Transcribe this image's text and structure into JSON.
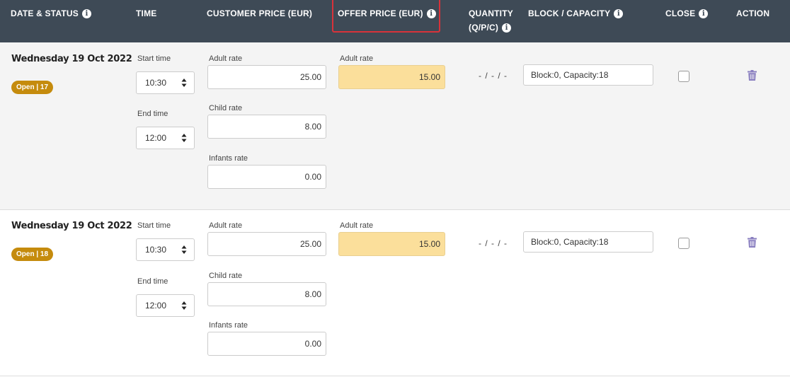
{
  "header": {
    "date_status": "DATE & STATUS",
    "time": "TIME",
    "customer_price": "CUSTOMER PRICE (EUR)",
    "offer_price": "OFFER PRICE (EUR)",
    "quantity_line1": "QUANTITY",
    "quantity_line2": "(Q/P/C)",
    "block_capacity": "BLOCK / CAPACITY",
    "close": "CLOSE",
    "action": "ACTION",
    "info_glyph": "i"
  },
  "rows": [
    {
      "date": "Wednesday 19 Oct 2022",
      "status": "Open | 17",
      "start_label": "Start time",
      "start_value": "10:30",
      "end_label": "End time",
      "end_value": "12:00",
      "adult_label": "Adult rate",
      "adult_value": "25.00",
      "child_label": "Child rate",
      "child_value": "8.00",
      "infant_label": "Infants rate",
      "infant_value": "0.00",
      "offer_label": "Adult rate",
      "offer_value": "15.00",
      "quantity": "- / - / -",
      "block": "Block:0, Capacity:18",
      "closed": false
    },
    {
      "date": "Wednesday 19 Oct 2022",
      "status": "Open | 18",
      "start_label": "Start time",
      "start_value": "10:30",
      "end_label": "End time",
      "end_value": "12:00",
      "adult_label": "Adult rate",
      "adult_value": "25.00",
      "child_label": "Child rate",
      "child_value": "8.00",
      "infant_label": "Infants rate",
      "infant_value": "0.00",
      "offer_label": "Adult rate",
      "offer_value": "15.00",
      "quantity": "- / - / -",
      "block": "Block:0, Capacity:18",
      "closed": false
    }
  ],
  "colors": {
    "header_bg": "#3e4a56",
    "badge": "#c58b0d",
    "offer_field": "#fbdf9b",
    "highlight_border": "#d8323a",
    "trash_icon": "#8a7fc0"
  },
  "icons": {
    "info": "info-icon",
    "select_arrows": "sort-arrows-icon",
    "delete": "trash-icon"
  }
}
